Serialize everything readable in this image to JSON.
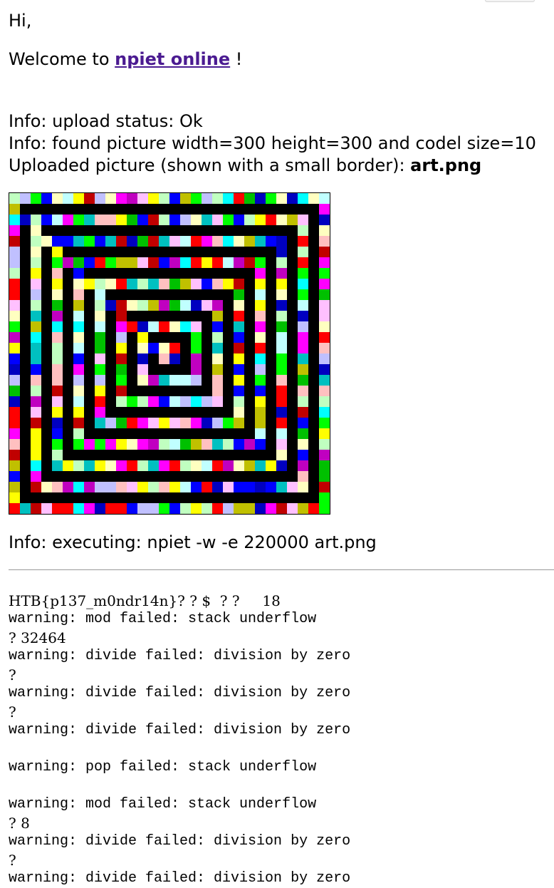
{
  "page": {
    "greeting": "Hi,",
    "welcome_prefix": "Welcome to",
    "welcome_link": "npiet online",
    "welcome_suffix": "!"
  },
  "info": {
    "upload_status": "Info: upload status: Ok",
    "picture_info": "Info: found picture width=300 height=300 and codel size=10",
    "uploaded_prefix": "Uploaded picture (shown with a small border):",
    "uploaded_file": "art.png",
    "executing": "Info: executing: npiet -w -e 220000 art.png"
  },
  "picture": {
    "grid_size": 30,
    "background": "#ffffff",
    "wall_color": "#000000",
    "palette": [
      "#ff0000",
      "#ffff00",
      "#00ff00",
      "#00ffff",
      "#0000ff",
      "#ff00ff",
      "#ffc0c0",
      "#ffffc0",
      "#c0ffc0",
      "#c0ffff",
      "#c0c0ff",
      "#ffc0ff",
      "#c0c000",
      "#00c0c0",
      "#c000c0",
      "#c00000",
      "#00c000",
      "#0000c0"
    ]
  },
  "output": {
    "lines": [
      {
        "text": "HTB{p137_m0ndr14n}? ? $  ? ?     18",
        "mono": false
      },
      {
        "text": "warning: mod failed: stack underflow",
        "mono": true
      },
      {
        "text": "? 32464",
        "mono": false
      },
      {
        "text": "warning: divide failed: division by zero",
        "mono": true
      },
      {
        "text": "?",
        "mono": false
      },
      {
        "text": "warning: divide failed: division by zero",
        "mono": true
      },
      {
        "text": "?",
        "mono": false
      },
      {
        "text": "warning: divide failed: division by zero",
        "mono": true
      },
      {
        "text": "",
        "mono": false
      },
      {
        "text": "warning: pop failed: stack underflow",
        "mono": true
      },
      {
        "text": "",
        "mono": false
      },
      {
        "text": "warning: mod failed: stack underflow",
        "mono": true
      },
      {
        "text": "? 8",
        "mono": false
      },
      {
        "text": "warning: divide failed: division by zero",
        "mono": true
      },
      {
        "text": "?",
        "mono": false
      },
      {
        "text": "warning: divide failed: division by zero",
        "mono": true
      }
    ]
  }
}
